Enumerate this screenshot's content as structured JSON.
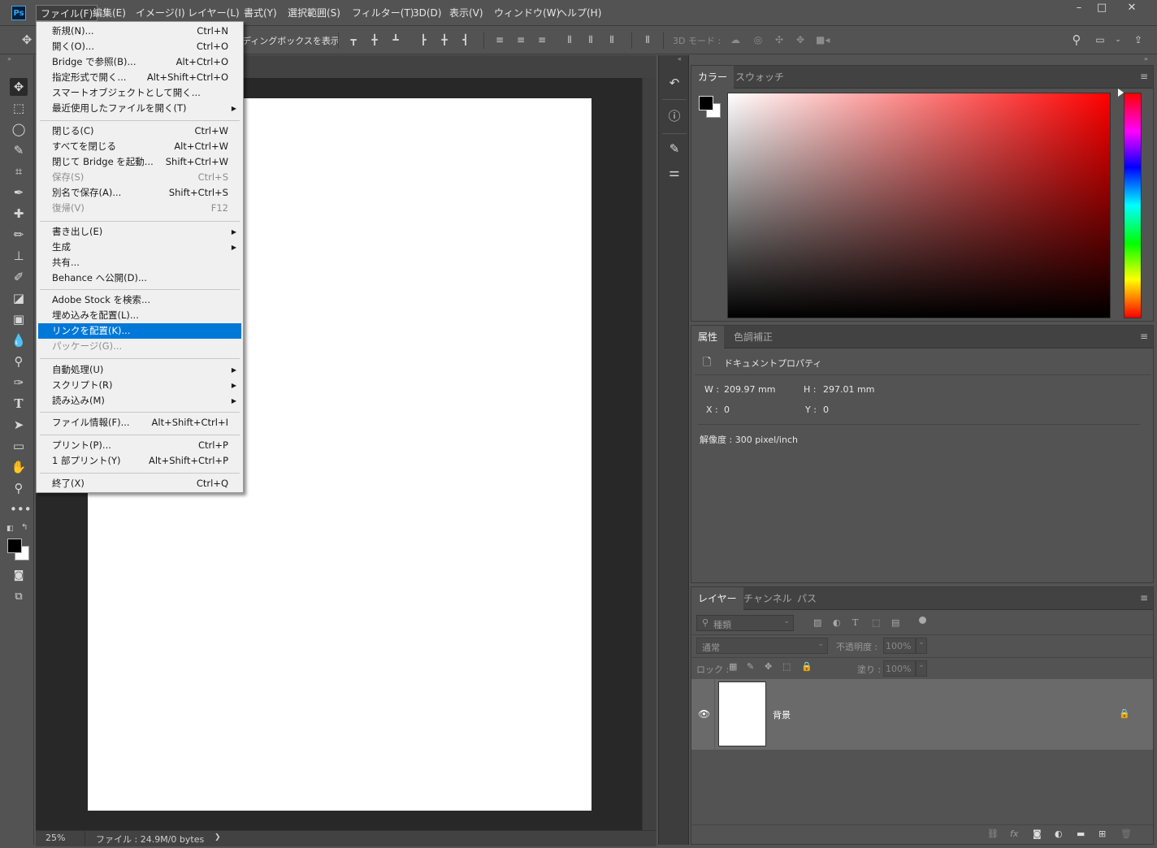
{
  "menubar": {
    "logo": "Ps",
    "items": [
      "ファイル(F)",
      "編集(E)",
      "イメージ(I)",
      "レイヤー(L)",
      "書式(Y)",
      "選択範囲(S)",
      "フィルター(T)",
      "3D(D)",
      "表示(V)",
      "ウィンドウ(W)",
      "ヘルプ(H)"
    ],
    "window_buttons": [
      "–",
      "□",
      "✕"
    ]
  },
  "options_bar": {
    "bounding_box_label": "ディングボックスを表示",
    "mode_3d_label": "3D モード :"
  },
  "file_menu": {
    "items": [
      {
        "label": "新規(N)...",
        "shortcut": "Ctrl+N"
      },
      {
        "label": "開く(O)...",
        "shortcut": "Ctrl+O"
      },
      {
        "label": "Bridge で参照(B)...",
        "shortcut": "Alt+Ctrl+O"
      },
      {
        "label": "指定形式で開く...",
        "shortcut": "Alt+Shift+Ctrl+O"
      },
      {
        "label": "スマートオブジェクトとして開く...",
        "shortcut": ""
      },
      {
        "label": "最近使用したファイルを開く(T)",
        "shortcut": "",
        "submenu": true
      },
      {
        "label": "閉じる(C)",
        "shortcut": "Ctrl+W"
      },
      {
        "label": "すべてを閉じる",
        "shortcut": "Alt+Ctrl+W"
      },
      {
        "label": "閉じて Bridge を起動...",
        "shortcut": "Shift+Ctrl+W"
      },
      {
        "label": "保存(S)",
        "shortcut": "Ctrl+S",
        "disabled": true
      },
      {
        "label": "別名で保存(A)...",
        "shortcut": "Shift+Ctrl+S"
      },
      {
        "label": "復帰(V)",
        "shortcut": "F12",
        "disabled": true
      },
      {
        "label": "書き出し(E)",
        "shortcut": "",
        "submenu": true
      },
      {
        "label": "生成",
        "shortcut": "",
        "submenu": true
      },
      {
        "label": "共有...",
        "shortcut": ""
      },
      {
        "label": "Behance へ公開(D)...",
        "shortcut": ""
      },
      {
        "label": "Adobe Stock を検索...",
        "shortcut": ""
      },
      {
        "label": "埋め込みを配置(L)...",
        "shortcut": ""
      },
      {
        "label": "リンクを配置(K)...",
        "shortcut": "",
        "highlighted": true
      },
      {
        "label": "パッケージ(G)...",
        "shortcut": "",
        "disabled": true
      },
      {
        "label": "自動処理(U)",
        "shortcut": "",
        "submenu": true
      },
      {
        "label": "スクリプト(R)",
        "shortcut": "",
        "submenu": true
      },
      {
        "label": "読み込み(M)",
        "shortcut": "",
        "submenu": true
      },
      {
        "label": "ファイル情報(F)...",
        "shortcut": "Alt+Shift+Ctrl+I"
      },
      {
        "label": "プリント(P)...",
        "shortcut": "Ctrl+P"
      },
      {
        "label": "1 部プリント(Y)",
        "shortcut": "Alt+Shift+Ctrl+P"
      },
      {
        "label": "終了(X)",
        "shortcut": "Ctrl+Q"
      }
    ]
  },
  "status": {
    "zoom": "25%",
    "file_info": "ファイル : 24.9M/0 bytes",
    "arrow": "❯"
  },
  "color_panel": {
    "tabs": [
      "カラー",
      "スウォッチ"
    ],
    "hue_color": "#ff0000"
  },
  "properties_panel": {
    "tabs": [
      "属性",
      "色調補正"
    ],
    "header": "ドキュメントプロパティ",
    "w_label": "W :",
    "w_value": "209.97 mm",
    "h_label": "H :",
    "h_value": "297.01 mm",
    "x_label": "X :",
    "x_value": "0",
    "y_label": "Y :",
    "y_value": "0",
    "resolution": "解像度 : 300 pixel/inch"
  },
  "layers_panel": {
    "tabs": [
      "レイヤー",
      "チャンネル",
      "パス"
    ],
    "filter_placeholder": "種類",
    "blend_mode": "通常",
    "opacity_label": "不透明度 :",
    "opacity_value": "100%",
    "lock_label": "ロック :",
    "fill_label": "塗り :",
    "fill_value": "100%",
    "layers": [
      {
        "name": "背景",
        "visible": true,
        "locked": true
      }
    ]
  }
}
